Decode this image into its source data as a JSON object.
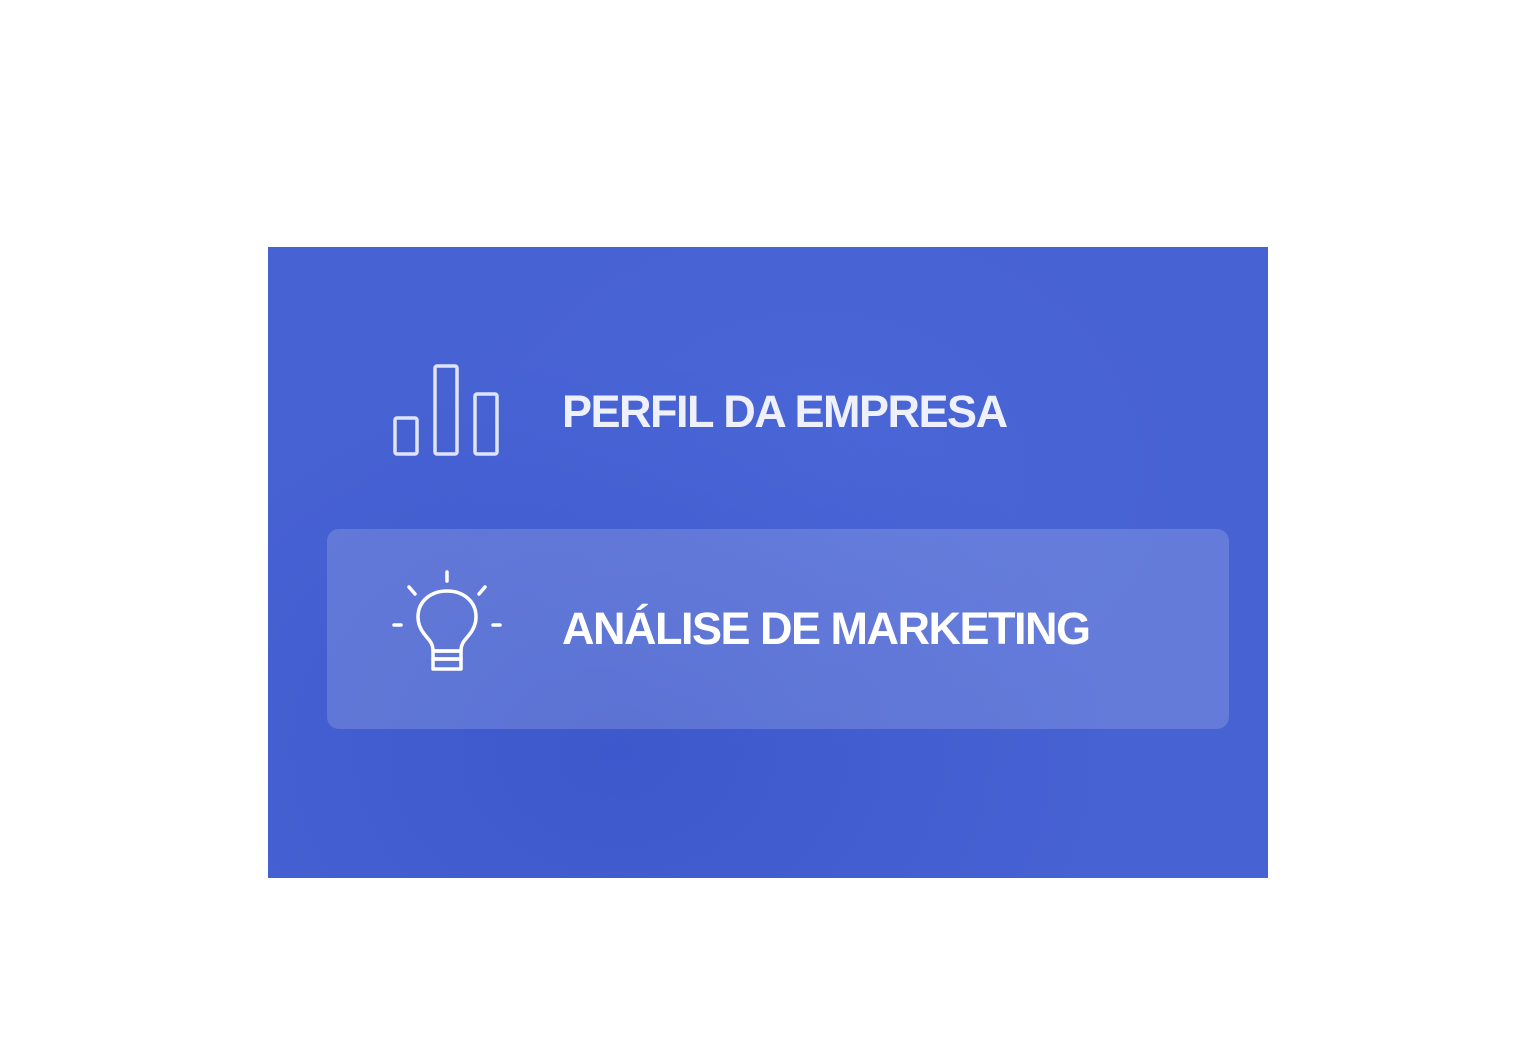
{
  "nav": {
    "items": [
      {
        "label": "PERFIL DA EMPRESA",
        "icon": "bar-chart-icon",
        "active": false
      },
      {
        "label": "ANÁLISE DE MARKETING",
        "icon": "lightbulb-icon",
        "active": true
      }
    ]
  },
  "colors": {
    "panel_background": "#4762d3",
    "active_item_background": "rgba(255,255,255,0.16)",
    "text": "#eef0fb"
  }
}
